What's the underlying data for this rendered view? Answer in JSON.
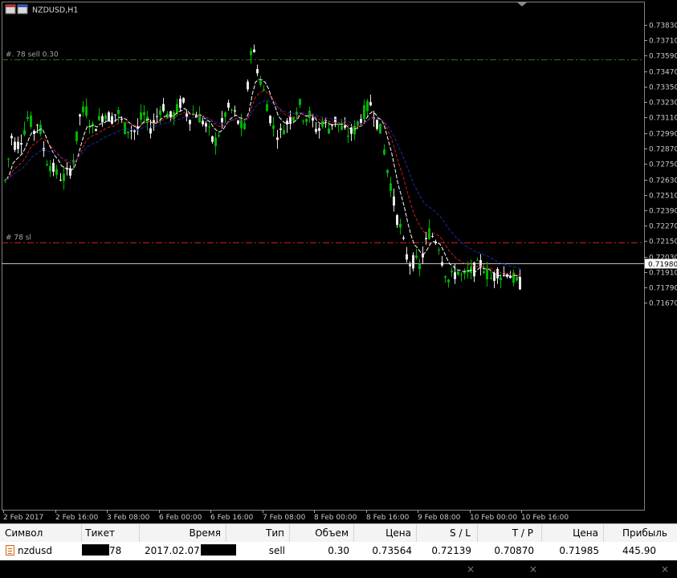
{
  "window": {
    "title": "NZDUSD,H1"
  },
  "colors": {
    "bull_candle": "#00b400",
    "bear_candle": "#e8e8e8",
    "ma_fast": "#ffffff",
    "ma_mid": "#c81e1e",
    "ma_slow": "#1c2aa8",
    "sell_line": "#2e6e22",
    "sl_line": "#c81e1e",
    "bid_line": "#c0c0c0",
    "grid_border": "#808080"
  },
  "chart_data": {
    "type": "candlestick",
    "symbol": "NZDUSD",
    "timeframe": "H1",
    "y_ticks": [
      "0.73830",
      "0.73710",
      "0.73590",
      "0.73470",
      "0.73350",
      "0.73230",
      "0.73110",
      "0.72990",
      "0.72870",
      "0.72750",
      "0.72630",
      "0.72510",
      "0.72390",
      "0.72270",
      "0.72150",
      "0.72030",
      "0.71910",
      "0.71790",
      "0.71670"
    ],
    "x_ticks": [
      "2 Feb 2017",
      "2 Feb 16:00",
      "3 Feb 08:00",
      "6 Feb 00:00",
      "6 Feb 16:00",
      "7 Feb 08:00",
      "8 Feb 00:00",
      "8 Feb 16:00",
      "9 Feb 08:00",
      "10 Feb 00:00",
      "10 Feb 16:00"
    ],
    "current_price": "0.71980",
    "levels": [
      {
        "name": "sell",
        "label": "#.     78 sell 0.30",
        "price": 0.73564,
        "style": "dash-dot"
      },
      {
        "name": "sl",
        "label": "#      78 sl",
        "price": 0.72139,
        "style": "dash-dot"
      }
    ],
    "moving_averages": [
      {
        "name": "fast",
        "style": "dashed"
      },
      {
        "name": "mid",
        "style": "dashed"
      },
      {
        "name": "slow",
        "style": "dashed"
      }
    ]
  },
  "terminal": {
    "headers": {
      "symbol": "Символ",
      "ticket": "Тикет",
      "time": "Время",
      "type": "Тип",
      "volume": "Объем",
      "price": "Цена",
      "sl": "S / L",
      "tp": "T / P",
      "cur_price": "Цена",
      "profit": "Прибыль"
    },
    "row": {
      "symbol": "nzdusd",
      "ticket_suffix": "78",
      "time_prefix": "2017.02.07",
      "type": "sell",
      "volume": "0.30",
      "price": "0.73564",
      "sl": "0.72139",
      "tp": "0.70870",
      "cur_price": "0.71985",
      "profit": "445.90",
      "close_glyph": "×"
    }
  }
}
